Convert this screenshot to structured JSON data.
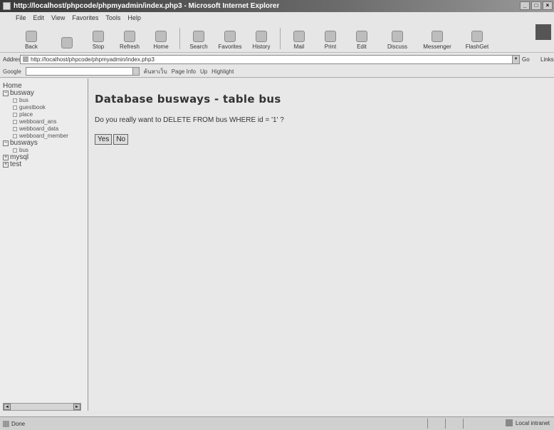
{
  "window": {
    "title": "http://localhost/phpcode/phpmyadmin/index.php3 - Microsoft Internet Explorer"
  },
  "menu": [
    "File",
    "Edit",
    "View",
    "Favorites",
    "Tools",
    "Help"
  ],
  "toolbar": {
    "back": "Back",
    "stop": "Stop",
    "refresh": "Refresh",
    "home": "Home",
    "search": "Search",
    "favorites": "Favorites",
    "history": "History",
    "mail": "Mail",
    "print": "Print",
    "edit": "Edit",
    "discuss": "Discuss",
    "messenger": "Messenger",
    "flashget": "FlashGet"
  },
  "address": {
    "label": "Address",
    "url": "http://localhost/phpcode/phpmyadmin/index.php3",
    "go": "Go",
    "links": "Links"
  },
  "searchbar": {
    "brand": "Google",
    "items": [
      "ค้นหาเว็บ",
      "Page Info",
      "Up",
      "Highlight"
    ]
  },
  "sidebar": {
    "home": "Home",
    "databases": [
      {
        "name": "busway",
        "expanded": true,
        "tables": [
          "bus",
          "guestbook",
          "place",
          "webboard_ans",
          "webboard_data",
          "webboard_member"
        ]
      },
      {
        "name": "busways",
        "expanded": true,
        "tables": [
          "bus"
        ]
      },
      {
        "name": "mysql",
        "expanded": false,
        "tables": []
      },
      {
        "name": "test",
        "expanded": false,
        "tables": []
      }
    ]
  },
  "main": {
    "title": "Database busways - table bus",
    "confirm": "Do you really want to DELETE FROM bus WHERE id = '1' ?",
    "yes": "Yes",
    "no": "No"
  },
  "status": {
    "text": "Done",
    "zone": "Local intranet"
  }
}
